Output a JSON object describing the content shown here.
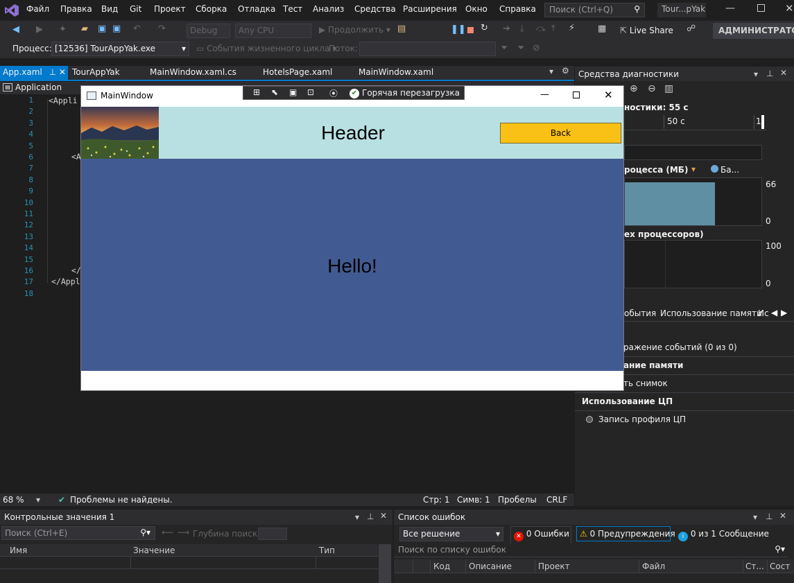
{
  "menu": [
    "Файл",
    "Правка",
    "Вид",
    "Git",
    "Проект",
    "Сборка",
    "Отладка",
    "Тест",
    "Анализ",
    "Средства",
    "Расширения",
    "Окно",
    "Справка"
  ],
  "search": {
    "placeholder": "Поиск (Ctrl+Q)"
  },
  "window_title": "Tour...pYak",
  "toolbar": {
    "config": "Debug",
    "platform": "Any CPU",
    "continue": "Продолжить",
    "live_share": "Live Share",
    "admin": "АДМИНИСТРАТОР"
  },
  "toolbar2": {
    "process_label": "Процесс:",
    "process_value": "[12536] TourAppYak.exe",
    "lifecycle": "События жизненного цикла",
    "thread_label": "Поток:"
  },
  "tabs": [
    "App.xaml",
    "TourAppYak",
    "MainWindow.xaml.cs",
    "HotelsPage.xaml",
    "MainWindow.xaml"
  ],
  "editor": {
    "nav": "Application",
    "lines": [
      "1",
      "2",
      "3",
      "4",
      "5",
      "6",
      "7",
      "8",
      "9",
      "10",
      "11",
      "12",
      "13",
      "14",
      "15",
      "16",
      "17",
      "18"
    ],
    "code_line1": "<Appli",
    "code_line6": "<A",
    "code_line16": "</",
    "code_line17": "</Appli",
    "zoom": "68 %",
    "no_problems": "Проблемы не найдены.",
    "pos_line": "Стр: 1",
    "pos_col": "Симв: 1",
    "spaces": "Пробелы",
    "eol": "CRLF"
  },
  "diagnostics": {
    "title": "Средства диагностики",
    "session": "ностики: 55 с",
    "timeline_50": "50 с",
    "timeline_1": "1:",
    "mem_title": "роцесса (МБ)",
    "legend_ba": "Ба...",
    "mem_max": "66",
    "mem_min": "0",
    "cpu_title": "ех процессоров)",
    "cpu_max": "100",
    "cpu_min": "0",
    "tabs": [
      "обытия",
      "Использование памяти",
      "Ис"
    ],
    "events_text": "ражение событий (0 из 0)",
    "mem_section": "ание памяти",
    "snapshot": "ть снимок",
    "cpu_section": "Использование ЦП",
    "cpu_record": "Запись профиля ЦП"
  },
  "watch": {
    "title": "Контрольные значения 1",
    "search_placeholder": "Поиск (Ctrl+E)",
    "depth_label": "Глубина поиска:",
    "col_name": "Имя",
    "col_value": "Значение",
    "col_type": "Тип"
  },
  "errors": {
    "title": "Список ошибок",
    "scope": "Все решение",
    "errors_btn": "0 Ошибки",
    "warnings_btn": "0 Предупреждения",
    "messages_btn": "0 из 1 Сообщение",
    "search_placeholder": "Поиск по списку ошибок",
    "col_code": "Код",
    "col_desc": "Описание",
    "col_project": "Проект",
    "col_file": "Файл",
    "col_line": "Ст...",
    "col_state": "Сост"
  },
  "wpf": {
    "title": "MainWindow",
    "hot_reload": "Горячая перезагрузка",
    "header": "Header",
    "back": "Back",
    "hello": "Hello!"
  },
  "colors": {
    "accent": "#007acc",
    "header_bg": "#b8e0e3",
    "body_bg": "#425a92",
    "back_btn": "#f9c116"
  }
}
